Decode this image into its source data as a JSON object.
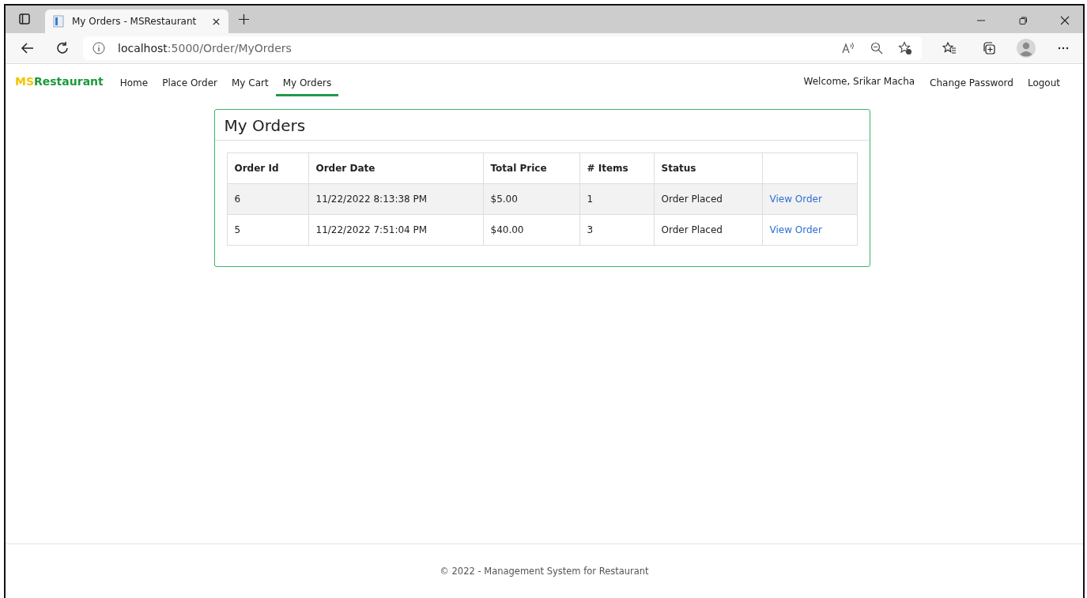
{
  "browser": {
    "tab_title": "My Orders - MSRestaurant",
    "url_host": "localhost",
    "url_path": ":5000/Order/MyOrders"
  },
  "navbar": {
    "brand": [
      {
        "text": "MS",
        "color": "#f5c400"
      },
      {
        "text": "Restaurant",
        "color": "#1a9a3a"
      }
    ],
    "links": [
      {
        "label": "Home",
        "selected": false
      },
      {
        "label": "Place Order",
        "selected": false
      },
      {
        "label": "My Cart",
        "selected": false
      },
      {
        "label": "My Orders",
        "selected": true
      }
    ],
    "welcome": "Welcome, Srikar Macha",
    "right_links": [
      "Change Password",
      "Logout"
    ]
  },
  "card": {
    "title": "My Orders",
    "columns": [
      "Order Id",
      "Order Date",
      "Total Price",
      "# Items",
      "Status"
    ],
    "rows": [
      {
        "id": "6",
        "date": "11/22/2022 8:13:38 PM",
        "price": "$5.00",
        "items": "1",
        "status": "Order Placed",
        "action": "View Order"
      },
      {
        "id": "5",
        "date": "11/22/2022 7:51:04 PM",
        "price": "$40.00",
        "items": "3",
        "status": "Order Placed",
        "action": "View Order"
      }
    ]
  },
  "footer": "© 2022 - Management System for Restaurant"
}
